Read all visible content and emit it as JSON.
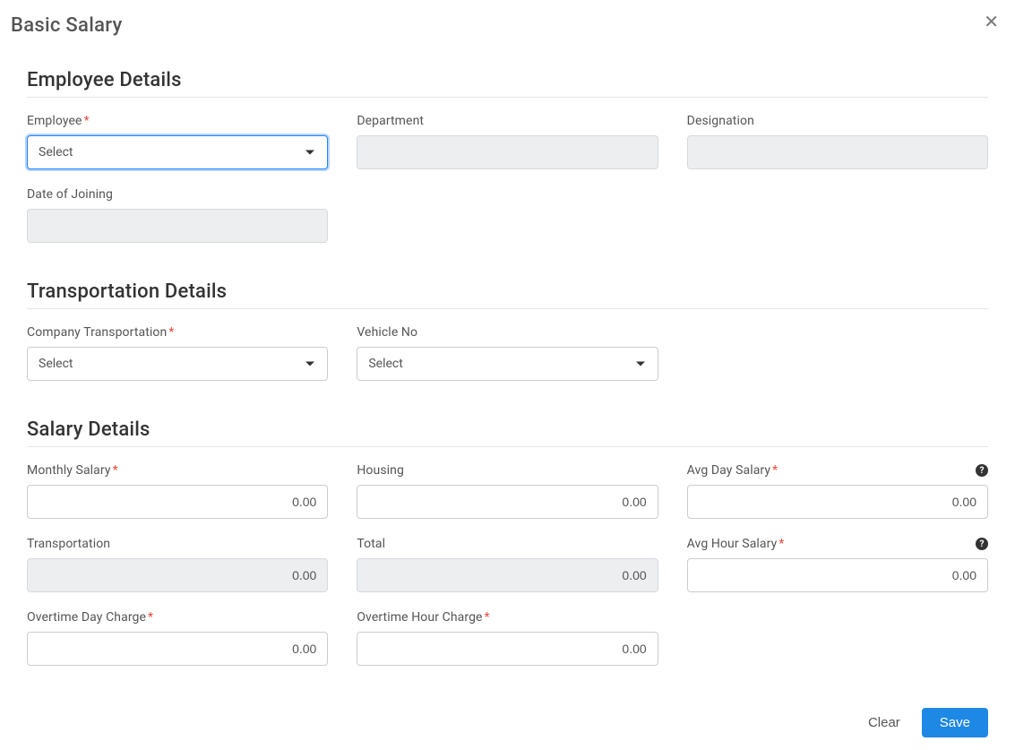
{
  "modal": {
    "title": "Basic Salary"
  },
  "sections": {
    "employee": {
      "heading": "Employee Details",
      "employee_label": "Employee",
      "employee_value": "Select",
      "department_label": "Department",
      "department_value": "",
      "designation_label": "Designation",
      "designation_value": "",
      "doj_label": "Date of Joining",
      "doj_value": ""
    },
    "transportation": {
      "heading": "Transportation Details",
      "company_trans_label": "Company Transportation",
      "company_trans_value": "Select",
      "vehicle_no_label": "Vehicle No",
      "vehicle_no_value": "Select"
    },
    "salary": {
      "heading": "Salary Details",
      "monthly_salary_label": "Monthly Salary",
      "monthly_salary_value": "0.00",
      "housing_label": "Housing",
      "housing_value": "0.00",
      "avg_day_label": "Avg Day Salary",
      "avg_day_value": "0.00",
      "transportation_label": "Transportation",
      "transportation_value": "0.00",
      "total_label": "Total",
      "total_value": "0.00",
      "avg_hour_label": "Avg Hour Salary",
      "avg_hour_value": "0.00",
      "ot_day_label": "Overtime Day Charge",
      "ot_day_value": "0.00",
      "ot_hour_label": "Overtime Hour Charge",
      "ot_hour_value": "0.00"
    }
  },
  "footer": {
    "clear_label": "Clear",
    "save_label": "Save"
  }
}
